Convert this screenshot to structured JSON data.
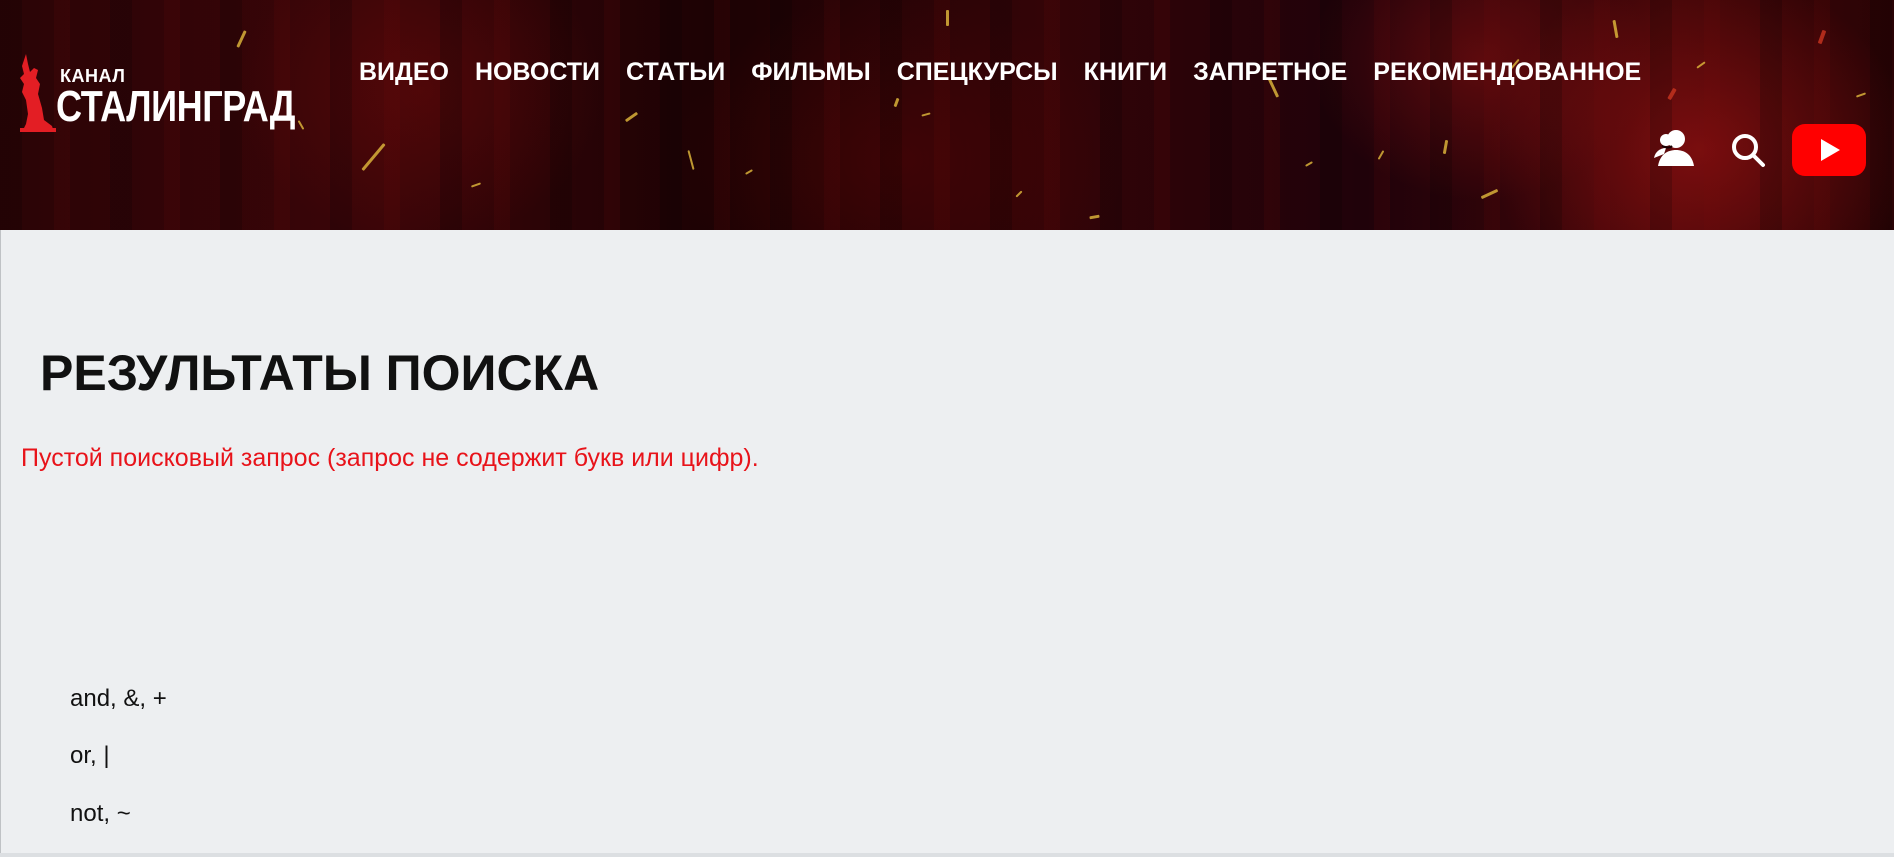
{
  "header": {
    "logo": {
      "small_text": "КАНАЛ",
      "big_text": "СТАЛИНГРАД",
      "accent_color": "#e31e24"
    },
    "nav": [
      {
        "label": "ВИДЕО"
      },
      {
        "label": "НОВОСТИ"
      },
      {
        "label": "СТАТЬИ"
      },
      {
        "label": "ФИЛЬМЫ"
      },
      {
        "label": "СПЕЦКУРСЫ"
      },
      {
        "label": "КНИГИ"
      },
      {
        "label": "ЗАПРЕТНОЕ"
      },
      {
        "label": "РЕКОМЕНДОВАННОЕ"
      }
    ],
    "icons": {
      "user": "user-icon",
      "search": "search-icon",
      "youtube": "youtube-icon",
      "youtube_color": "#ff0000"
    }
  },
  "main": {
    "title": "РЕЗУЛЬТАТЫ ПОИСКА",
    "error": "Пустой поисковый запрос (запрос не содержит букв или цифр).",
    "error_color": "#e8131a",
    "operators": [
      "and, &, +",
      "or, |",
      "not, ~"
    ]
  }
}
